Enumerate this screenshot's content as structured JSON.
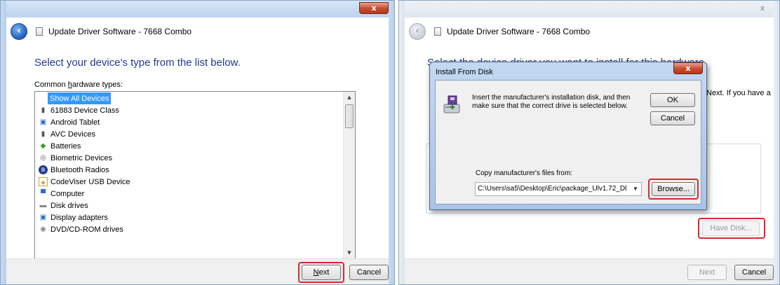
{
  "left_window": {
    "title": "Update Driver Software - 7668 Combo",
    "close_glyph": "x",
    "heading": "Select your device's type from the list below.",
    "list_label_pre": "Common ",
    "list_label_underlined": "h",
    "list_label_post": "ardware types:",
    "items": [
      {
        "label": "Show All Devices",
        "icon": "none",
        "selected": true
      },
      {
        "label": "61883 Device Class",
        "icon": "device-icon"
      },
      {
        "label": "Android Tablet",
        "icon": "tablet-icon"
      },
      {
        "label": "AVC Devices",
        "icon": "device-icon"
      },
      {
        "label": "Batteries",
        "icon": "battery-icon"
      },
      {
        "label": "Biometric Devices",
        "icon": "fingerprint-icon"
      },
      {
        "label": "Bluetooth Radios",
        "icon": "bluetooth-icon"
      },
      {
        "label": "CodeViser USB Device",
        "icon": "usb-icon"
      },
      {
        "label": "Computer",
        "icon": "computer-icon"
      },
      {
        "label": "Disk drives",
        "icon": "disk-drive-icon"
      },
      {
        "label": "Display adapters",
        "icon": "display-icon"
      },
      {
        "label": "DVD/CD-ROM drives",
        "icon": "dvd-icon"
      }
    ],
    "next_label_underlined": "N",
    "next_label_rest": "ext",
    "cancel_label": "Cancel"
  },
  "right_window": {
    "title": "Update Driver Software - 7668 Combo",
    "close_glyph": "x",
    "heading_partial": "Select the device driver you want to install for this hardware.",
    "side_text": "Next. If you have a",
    "have_disk_label": "Have Disk...",
    "next_label": "Next",
    "cancel_label": "Cancel"
  },
  "dialog": {
    "title": "Install From Disk",
    "close_glyph": "x",
    "message": "Insert the manufacturer's installation disk, and then make sure that the correct drive is selected below.",
    "ok_label": "OK",
    "cancel_label": "Cancel",
    "copy_label": "Copy manufacturer's files from:",
    "path_value": "C:\\Users\\sa5\\Desktop\\Eric\\package_Ulv1.72_Dl",
    "browse_label": "Browse..."
  },
  "colors": {
    "accent": "#1e3c8c",
    "selection": "#3399ff",
    "highlight": "#e0252d"
  }
}
